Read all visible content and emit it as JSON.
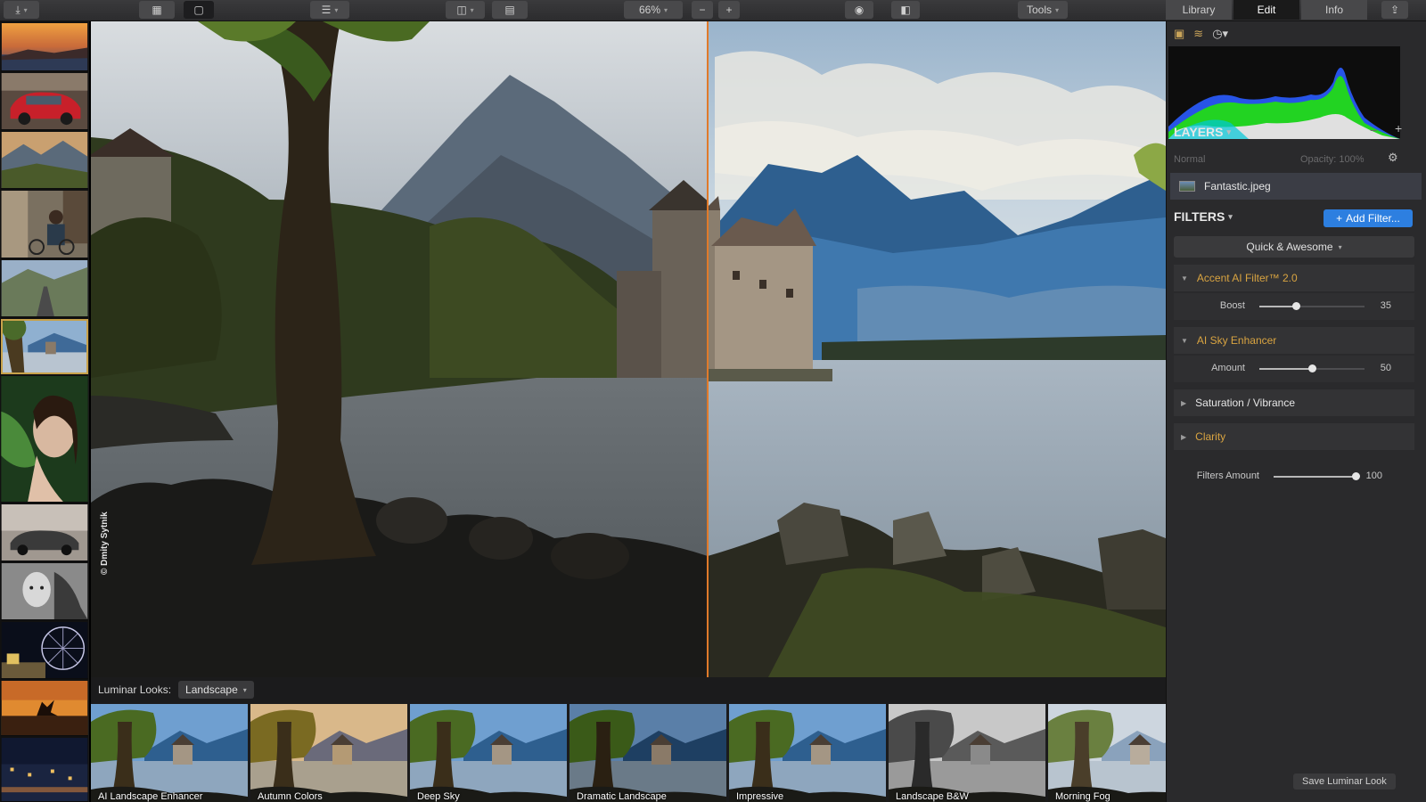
{
  "toolbar": {
    "zoom": "66%",
    "tools_label": "Tools",
    "tabs": [
      "Library",
      "Edit",
      "Info"
    ],
    "active_tab": "Edit"
  },
  "filmstrip": {
    "selected_index": 5,
    "thumbnails": [
      "sunset-lake",
      "red-car",
      "mountain-valley",
      "street-cyclist",
      "mountain-road",
      "castle-lake",
      "woman-leaf",
      "vintage-car",
      "bw-child",
      "ferris-wheel",
      "sunset-runner",
      "city-night"
    ]
  },
  "canvas": {
    "credit": "© Dmity Sytnik"
  },
  "looks": {
    "label": "Luminar Looks:",
    "category": "Landscape",
    "items": [
      {
        "name": "AI Landscape Enhancer",
        "style": "color"
      },
      {
        "name": "Autumn Colors",
        "style": "warm"
      },
      {
        "name": "Deep Sky",
        "style": "color"
      },
      {
        "name": "Dramatic Landscape",
        "style": "dramatic"
      },
      {
        "name": "Impressive",
        "style": "color"
      },
      {
        "name": "Landscape B&W",
        "style": "bw"
      },
      {
        "name": "Morning Fog",
        "style": "fog"
      }
    ]
  },
  "panel": {
    "layers_title": "LAYERS",
    "blend_mode": "Normal",
    "opacity_label": "Opacity: 100%",
    "layer_name": "Fantastic.jpeg",
    "filters_title": "FILTERS",
    "add_filter_label": "Add Filter...",
    "preset_label": "Quick & Awesome",
    "filters": [
      {
        "name": "Accent AI Filter™ 2.0",
        "expanded": true,
        "color": "gold",
        "slider": {
          "label": "Boost",
          "value": 35
        }
      },
      {
        "name": "AI Sky Enhancer",
        "expanded": true,
        "color": "gold",
        "slider": {
          "label": "Amount",
          "value": 50
        }
      },
      {
        "name": "Saturation / Vibrance",
        "expanded": false,
        "color": "white"
      },
      {
        "name": "Clarity",
        "expanded": false,
        "color": "gold"
      }
    ],
    "filters_amount": {
      "label": "Filters Amount",
      "value": 100
    },
    "save_look_label": "Save Luminar Look"
  },
  "colors": {
    "accent_gold": "#d9a441",
    "accent_blue": "#2d7fe0",
    "split_line": "#e07a2a"
  }
}
